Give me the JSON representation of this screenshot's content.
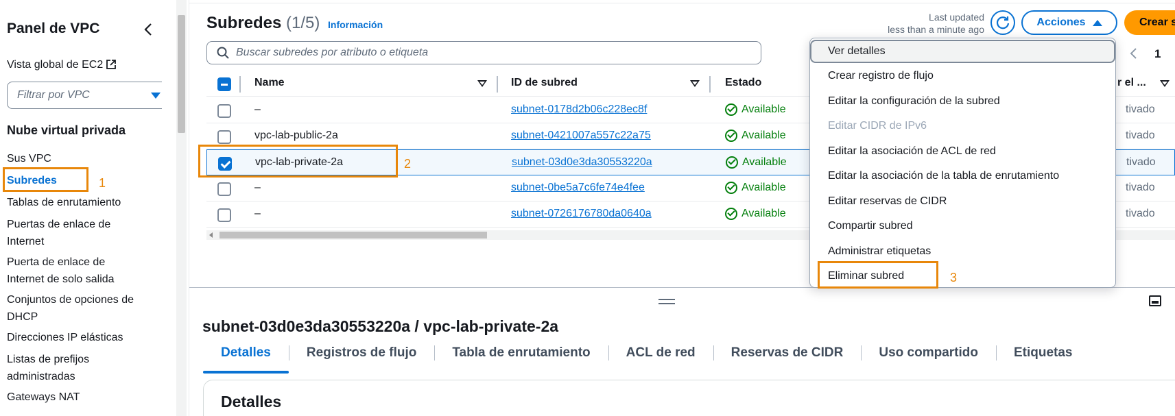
{
  "sidebar": {
    "title": "Panel de VPC",
    "global_view": "Vista global de EC2",
    "filter_placeholder": "Filtrar por VPC",
    "section": "Nube virtual privada",
    "items": [
      {
        "label": "Sus VPC"
      },
      {
        "label": "Subredes"
      },
      {
        "label": "Tablas de enrutamiento"
      },
      {
        "label": "Puertas de enlace de Internet"
      },
      {
        "label": "Puerta de enlace de Internet de solo salida"
      },
      {
        "label": "Conjuntos de opciones de DHCP"
      },
      {
        "label": "Direcciones IP elásticas"
      },
      {
        "label": "Listas de prefijos administradas"
      },
      {
        "label": "Gateways NAT"
      }
    ]
  },
  "header": {
    "title": "Subredes",
    "count": "(1/5)",
    "info": "Información",
    "last_updated_1": "Last updated",
    "last_updated_2": "less than a minute ago",
    "actions_label": "Acciones",
    "create_label": "Crear subred"
  },
  "search": {
    "placeholder": "Buscar subredes por atributo o etiqueta"
  },
  "pager": {
    "page": "1"
  },
  "table": {
    "columns": [
      "Name",
      "ID de subred",
      "Estado",
      "r el ..."
    ],
    "rows": [
      {
        "name": "–",
        "id": "subnet-0178d2b06c228ec8f",
        "status": "Available",
        "extra": "tivado"
      },
      {
        "name": "vpc-lab-public-2a",
        "id": "subnet-0421007a557c22a75",
        "status": "Available",
        "extra": "tivado"
      },
      {
        "name": "vpc-lab-private-2a",
        "id": "subnet-03d0e3da30553220a",
        "status": "Available",
        "extra": "tivado"
      },
      {
        "name": "–",
        "id": "subnet-0be5a7c6fe74e4fee",
        "status": "Available",
        "extra": "tivado"
      },
      {
        "name": "–",
        "id": "subnet-0726176780da0640a",
        "status": "Available",
        "extra": "tivado"
      }
    ]
  },
  "menu": {
    "items": [
      {
        "label": "Ver detalles",
        "state": "hovered"
      },
      {
        "label": "Crear registro de flujo",
        "state": "normal"
      },
      {
        "label": "Editar la configuración de la subred",
        "state": "normal"
      },
      {
        "label": "Editar CIDR de IPv6",
        "state": "disabled"
      },
      {
        "label": "Editar la asociación de ACL de red",
        "state": "normal"
      },
      {
        "label": "Editar la asociación de la tabla de enrutamiento",
        "state": "normal"
      },
      {
        "label": "Editar reservas de CIDR",
        "state": "normal"
      },
      {
        "label": "Compartir subred",
        "state": "normal"
      },
      {
        "label": "Administrar etiquetas",
        "state": "normal"
      },
      {
        "label": "Eliminar subred",
        "state": "normal"
      }
    ]
  },
  "annotations": {
    "one": "1",
    "two": "2",
    "three": "3"
  },
  "detail": {
    "title": "subnet-03d0e3da30553220a / vpc-lab-private-2a",
    "tabs": [
      "Detalles",
      "Registros de flujo",
      "Tabla de enrutamiento",
      "ACL de red",
      "Reservas de CIDR",
      "Uso compartido",
      "Etiquetas"
    ],
    "card_title": "Detalles"
  },
  "colors": {
    "accent": "#0972d3",
    "primary_button": "#ff9900",
    "success": "#037f0c",
    "annotation": "#e8870a"
  }
}
